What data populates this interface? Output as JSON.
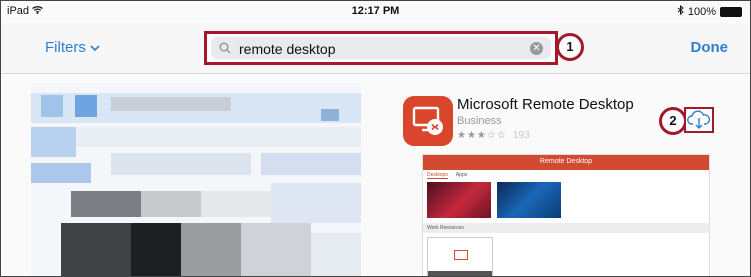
{
  "status_bar": {
    "device": "iPad",
    "time": "12:17 PM",
    "battery": "100%"
  },
  "navbar": {
    "filters_label": "Filters",
    "done_label": "Done",
    "search": {
      "value": "remote desktop",
      "placeholder": ""
    }
  },
  "callouts": [
    "1",
    "2"
  ],
  "result": {
    "app_name": "Microsoft Remote Desktop",
    "category": "Business",
    "stars": "★★★☆☆",
    "rating_count": "193",
    "preview": {
      "title": "Remote Desktop",
      "tabs": [
        "Desktops",
        "Apps"
      ],
      "section": "Work Resources"
    }
  },
  "colors": {
    "accent": "#2f7fd1",
    "callout": "#a3192b",
    "app_icon": "#d9462b"
  }
}
